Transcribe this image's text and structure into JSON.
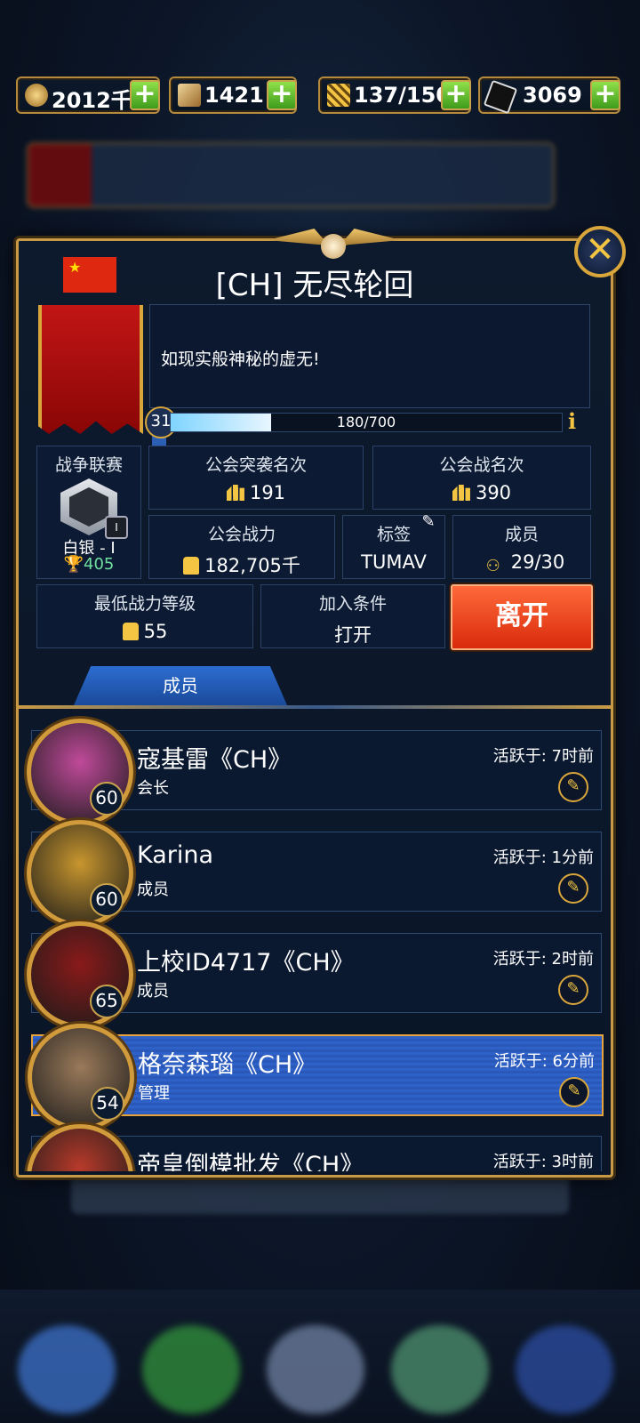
{
  "resources": [
    {
      "name": "gold",
      "value": "2012千",
      "icon": "skull-coin-icon",
      "color": "#d9a63c"
    },
    {
      "name": "requisition",
      "value": "1421",
      "icon": "scroll-icon",
      "color": "#d8b36a"
    },
    {
      "name": "energy",
      "value": "137/150",
      "icon": "ammo-icon",
      "color": "#d9a63c"
    },
    {
      "name": "blackstone",
      "value": "3069",
      "icon": "blackstone-icon",
      "color": "#1a1a1a"
    }
  ],
  "guild": {
    "name": "[CH] 无尽轮回",
    "description": "如现实般神秘的虚无!",
    "level": "31",
    "xp_text": "180/700",
    "xp_fraction": 0.257,
    "flag": "china-flag"
  },
  "stats": {
    "league_label": "战争联赛",
    "league_rank": "白银 - I",
    "league_tier": "I",
    "league_trophies": "405",
    "raid_rank_label": "公会突袭名次",
    "raid_rank": "191",
    "war_rank_label": "公会战名次",
    "war_rank": "390",
    "power_label": "公会战力",
    "power": "182,705千",
    "tag_label": "标签",
    "tag": "TUMAV",
    "members_label": "成员",
    "members": "29/30",
    "min_power_label": "最低战力等级",
    "min_power": "55",
    "join_label": "加入条件",
    "join": "打开",
    "leave_button": "离开"
  },
  "tab_label": "成员",
  "members": [
    {
      "name": "寇基雷《CH》",
      "role": "会长",
      "level": "60",
      "active": "活跃于: 7时前",
      "avatar_color": "#c04a9a",
      "highlight": false
    },
    {
      "name": "Karina",
      "role": "成员",
      "level": "60",
      "active": "活跃于: 1分前",
      "avatar_color": "#c8962e",
      "highlight": false
    },
    {
      "name": "上校ID4717《CH》",
      "role": "成员",
      "level": "65",
      "active": "活跃于: 2时前",
      "avatar_color": "#8a1a1a",
      "highlight": false
    },
    {
      "name": "格奈森瑙《CH》",
      "role": "管理",
      "level": "54",
      "active": "活跃于: 6分前",
      "avatar_color": "#9a7a5a",
      "highlight": true
    },
    {
      "name": "帝皇倒模批发《CH》",
      "role": "",
      "level": "",
      "active": "活跃于: 3时前",
      "avatar_color": "#b83a2a",
      "highlight": false
    }
  ]
}
